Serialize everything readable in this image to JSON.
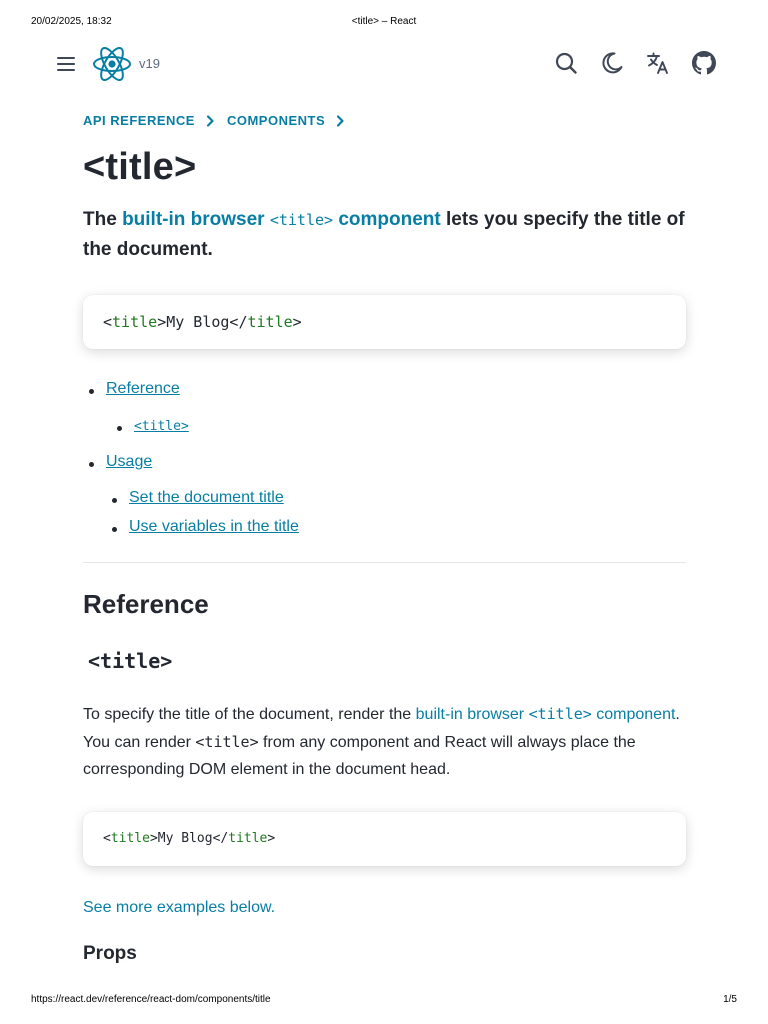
{
  "print": {
    "date": "20/02/2025, 18:32",
    "doc_title": "<title> – React",
    "url": "https://react.dev/reference/react-dom/components/title",
    "page": "1/5"
  },
  "nav": {
    "version": "v19",
    "icons": [
      "menu-icon",
      "react-logo-icon",
      "search-icon",
      "moon-icon",
      "translate-icon",
      "github-icon"
    ]
  },
  "breadcrumbs": [
    "API REFERENCE",
    "COMPONENTS"
  ],
  "title": "<title>",
  "intro": {
    "prefix": "The ",
    "link_text_1": "built-in browser",
    "link_code": "<title>",
    "link_text_2": "component",
    "suffix": " lets you specify the title of the document."
  },
  "code_example_1": {
    "open_bracket": "<",
    "open_tag": "title",
    "mid": ">My Blog</",
    "close_tag": "title",
    "close_bracket": ">"
  },
  "toc": {
    "reference": "Reference",
    "title_code": "<title>",
    "usage": "Usage",
    "set_title": "Set the document title",
    "use_variables": "Use variables in the title"
  },
  "reference": {
    "heading": "Reference",
    "subheading": "<title>",
    "para_1": "To specify the title of the document, render the ",
    "link_1": "built-in browser",
    "link_code": "<title>",
    "link_2": "component",
    "para_2": ". You can render ",
    "code_inline": "<title>",
    "para_3": " from any component and React will always place the corresponding DOM element in the document head."
  },
  "code_example_2": {
    "open_bracket": "<",
    "open_tag": "title",
    "mid": ">My Blog</",
    "close_tag": "title",
    "close_bracket": ">"
  },
  "see_more": "See more examples below.",
  "props_heading": "Props",
  "colors": {
    "link": "#087ea4",
    "text": "#23272f",
    "code_tag": "#1f7a1f",
    "secondary": "#5e687e"
  }
}
